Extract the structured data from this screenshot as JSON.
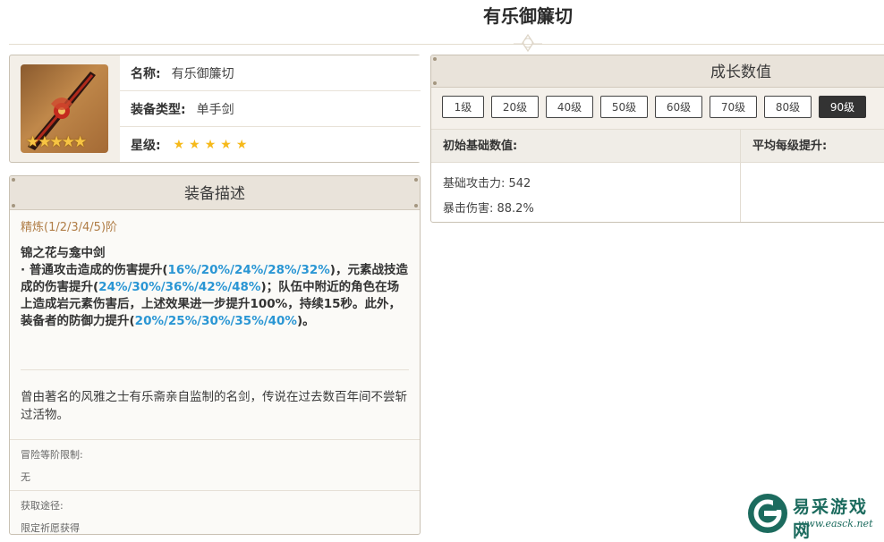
{
  "page": {
    "title": "有乐御簾切"
  },
  "info": {
    "name_label": "名称:",
    "name_value": "有乐御簾切",
    "type_label": "装备类型:",
    "type_value": "单手剑",
    "rarity_label": "星级:",
    "rarity_stars": 5
  },
  "description": {
    "header": "装备描述",
    "refinement": "精炼(1/2/3/4/5)阶",
    "passive_name": "锦之花与龛中剑",
    "passive_parts": [
      {
        "t": "· 普通攻击造成的伤害提升(",
        "blue": false
      },
      {
        "t": "16%/20%/24%/28%/32%",
        "blue": true
      },
      {
        "t": ")，元素战技造成的伤害提升(",
        "blue": false
      },
      {
        "t": "24%/30%/36%/42%/48%",
        "blue": true
      },
      {
        "t": ")；队伍中附近的角色在场上造成岩元素伤害后，上述效果进一步提升100%，持续15秒。此外，装备者的防御力提升(",
        "blue": false
      },
      {
        "t": "20%/25%/30%/35%/40%",
        "blue": true
      },
      {
        "t": ")。",
        "blue": false
      }
    ],
    "lore": "曾由著名的风雅之士有乐斋亲自监制的名剑，传说在过去数百年间不尝斩过活物。",
    "ascension_label": "冒险等阶限制:",
    "ascension_value": "无",
    "source_label": "获取途径:",
    "source_value": "限定祈愿获得"
  },
  "growth": {
    "header": "成长数值",
    "levels": [
      "1级",
      "20级",
      "40级",
      "50级",
      "60级",
      "70级",
      "80级",
      "90级"
    ],
    "active_level": "90级",
    "col_base": "初始基础数值:",
    "col_per_level": "平均每级提升:",
    "stats": [
      "基础攻击力: 542",
      "暴击伤害: 88.2%"
    ]
  },
  "watermark": {
    "brand": "易采游戏网",
    "url": "www.easck.net"
  },
  "colors": {
    "highlight_blue": "#2a96d4",
    "refine_orange": "#b07d46",
    "star_gold": "#f6b91a"
  }
}
